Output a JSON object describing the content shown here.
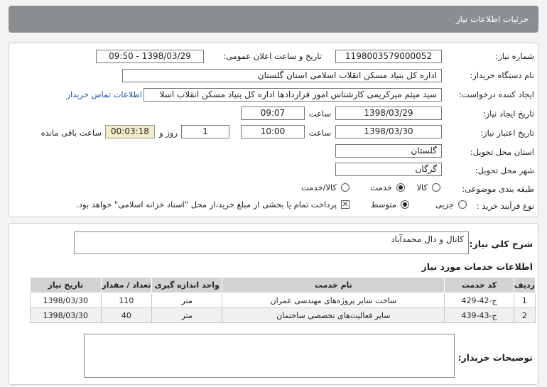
{
  "header": {
    "title": "جزئیات اطلاعات نیاز"
  },
  "fields": {
    "need_number_label": "شماره نیاز:",
    "need_number": "1198003579000052",
    "announce_label": "تاریخ و ساعت اعلان عمومی:",
    "announce_value": "1398/03/29 - 09:50",
    "buyer_org_label": "نام دستگاه خریدار:",
    "buyer_org": "اداره کل بنیاد مسکن انقلاب اسلامی استان گلستان",
    "creator_label": "ایجاد کننده درخواست:",
    "creator": "سید میثم میرکریمی کارشناس امور قراردادها اداره کل بنیاد مسکن انقلاب اسلا",
    "contact_link": "اطلاعات تماس خریدار",
    "created_date_label": "تاریخ ایجاد نیاز:",
    "created_date": "1398/03/29",
    "time_label": "ساعت",
    "created_time": "09:07",
    "validity_label": "تاریخ اعتبار نیاز:",
    "validity_date": "1398/03/30",
    "validity_time": "10:00",
    "days": "1",
    "days_label": "روز و",
    "remaining": "00:03:18",
    "remaining_label": "ساعت باقی مانده",
    "province_label": "استان محل تحویل:",
    "province": "گلستان",
    "city_label": "شهر محل تحویل:",
    "city": "گرگان",
    "category_label": "طبقه بندی موضوعی:",
    "category_options": [
      "کالا",
      "خدمت",
      "کالا/خدمت"
    ],
    "category_selected": "خدمت",
    "process_label": "نوع فرآیند خرید :",
    "process_options": [
      "جزیی",
      "متوسط"
    ],
    "process_selected": "متوسط",
    "payment_note": "پرداخت تمام یا بخشی از مبلغ خرید،از محل \"اسناد خزانه اسلامی\" خواهد بود."
  },
  "summary": {
    "label": "شرح کلی نیاز:",
    "value": "کانال و دال محمدآباد"
  },
  "services": {
    "title": "اطلاعات خدمات مورد نیاز",
    "columns": [
      "ردیف",
      "کد خدمت",
      "نام خدمت",
      "واحد اندازه گیری",
      "تعداد / مقدار",
      "تاریخ نیاز"
    ],
    "rows": [
      [
        "1",
        "ج-42-429",
        "ساخت سایر پروژه‌های مهندسی عمران",
        "متر",
        "110",
        "1398/03/30"
      ],
      [
        "2",
        "ج-43-439",
        "سایر فعالیت‌های تخصصی ساختمان",
        "متر",
        "40",
        "1398/03/30"
      ]
    ]
  },
  "buyer_notes": {
    "label": "توضیحات خریدار:",
    "value": ""
  }
}
